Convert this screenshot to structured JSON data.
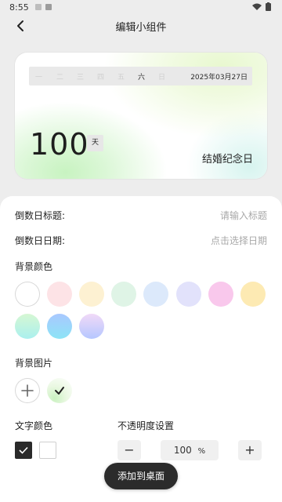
{
  "status_bar": {
    "time": "8:55"
  },
  "header": {
    "title": "编辑小组件"
  },
  "preview": {
    "weekdays": [
      "一",
      "二",
      "三",
      "四",
      "五",
      "六",
      "日"
    ],
    "active_weekday_index": 5,
    "date": "2025年03月27日",
    "days": "100",
    "unit": "天",
    "label": "结婚纪念日"
  },
  "form": {
    "title_label": "倒数日标题:",
    "title_placeholder": "请输入标题",
    "date_label": "倒数日日期:",
    "date_placeholder": "点击选择日期"
  },
  "background_color": {
    "heading": "背景颜色",
    "swatches": [
      "#ffffff",
      "#fde3e6",
      "#fdf1d2",
      "#dff4e6",
      "#dce9fb",
      "#e2e2fb",
      "#f9c8ec",
      "#fdeab3",
      "linear-gradient(180deg,#d6f7d3,#aaf0ee)",
      "linear-gradient(180deg,#a9c8ff,#8de4f6)",
      "linear-gradient(180deg,#f1d9f7,#b5c7ff)"
    ]
  },
  "background_image": {
    "heading": "背景图片",
    "selected": true
  },
  "text_color": {
    "heading": "文字颜色",
    "options": [
      "#2a2a2a",
      "#ffffff"
    ],
    "selected_index": 0
  },
  "opacity": {
    "heading": "不透明度设置",
    "value": "100",
    "unit": "%",
    "minus": "−",
    "plus": "+"
  },
  "action": {
    "add_label": "添加到桌面"
  }
}
